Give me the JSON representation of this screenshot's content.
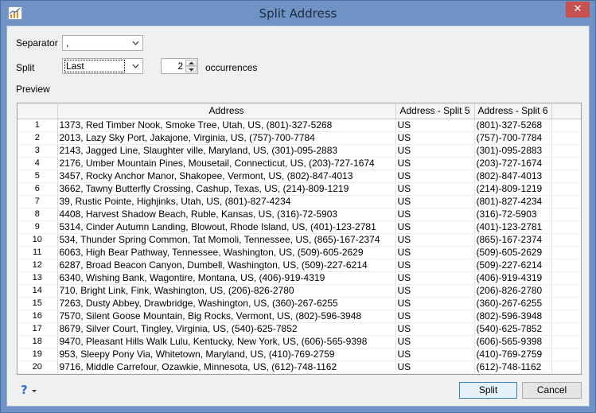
{
  "window": {
    "title": "Split Address",
    "close_symbol": "✕",
    "app_icon": "chart-icon"
  },
  "form": {
    "separator_label": "Separator",
    "separator_value": ",",
    "split_label": "Split",
    "split_value": "Last",
    "occurrences_value": "2",
    "occurrences_label": "occurrences",
    "preview_label": "Preview"
  },
  "table": {
    "columns": [
      "",
      "Address",
      "Address - Split 5",
      "Address - Split 6"
    ],
    "rows": [
      [
        "1",
        "1373, Red Timber Nook, Smoke Tree, Utah, US, (801)-327-5268",
        "US",
        "(801)-327-5268"
      ],
      [
        "2",
        "2013, Lazy Sky Port, Jakajone, Virginia, US, (757)-700-7784",
        "US",
        "(757)-700-7784"
      ],
      [
        "3",
        "2143, Jagged Line, Slaughter ville, Maryland, US, (301)-095-2883",
        "US",
        "(301)-095-2883"
      ],
      [
        "4",
        "2176, Umber Mountain Pines, Mousetail, Connecticut, US, (203)-727-1674",
        "US",
        "(203)-727-1674"
      ],
      [
        "5",
        "3457, Rocky Anchor Manor, Shakopee, Vermont, US, (802)-847-4013",
        "US",
        "(802)-847-4013"
      ],
      [
        "6",
        "3662, Tawny Butterfly Crossing, Cashup, Texas, US, (214)-809-1219",
        "US",
        "(214)-809-1219"
      ],
      [
        "7",
        "39, Rustic Pointe, Highjinks, Utah, US, (801)-827-4234",
        "US",
        "(801)-827-4234"
      ],
      [
        "8",
        "4408, Harvest Shadow Beach, Ruble, Kansas, US, (316)-72-5903",
        "US",
        "(316)-72-5903"
      ],
      [
        "9",
        "5314, Cinder Autumn Landing, Blowout, Rhode Island, US, (401)-123-2781",
        "US",
        "(401)-123-2781"
      ],
      [
        "10",
        "534, Thunder Spring Common, Tat Momoli, Tennessee, US, (865)-167-2374",
        "US",
        "(865)-167-2374"
      ],
      [
        "11",
        "6063, High Bear Pathway, Tennessee, Washington, US, (509)-605-2629",
        "US",
        "(509)-605-2629"
      ],
      [
        "12",
        "6287, Broad Beacon Canyon, Dumbell, Washington, US, (509)-227-6214",
        "US",
        "(509)-227-6214"
      ],
      [
        "13",
        "6340, Wishing Bank, Wagontire, Montana, US, (406)-919-4319",
        "US",
        "(406)-919-4319"
      ],
      [
        "14",
        "710, Bright Link, Fink, Washington, US, (206)-826-2780",
        "US",
        "(206)-826-2780"
      ],
      [
        "15",
        "7263, Dusty Abbey, Drawbridge, Washington, US, (360)-267-6255",
        "US",
        "(360)-267-6255"
      ],
      [
        "16",
        "7570, Silent Goose Mountain, Big Rocks, Vermont, US, (802)-596-3948",
        "US",
        "(802)-596-3948"
      ],
      [
        "17",
        "8679, Silver Court, Tingley, Virginia, US, (540)-625-7852",
        "US",
        "(540)-625-7852"
      ],
      [
        "18",
        "9470, Pleasant Hills Walk Lulu, Kentucky, New York, US, (606)-565-9398",
        "US",
        "(606)-565-9398"
      ],
      [
        "19",
        "953, Sleepy Pony Via, Whitetown, Maryland, US, (410)-769-2759",
        "US",
        "(410)-769-2759"
      ],
      [
        "20",
        "9716, Middle Carrefour, Ozawkie, Minnesota, US, (612)-748-1162",
        "US",
        "(612)-748-1162"
      ]
    ]
  },
  "footer": {
    "help_icon": "help-icon",
    "help_glyph": "?",
    "split_button": "Split",
    "cancel_button": "Cancel"
  },
  "colors": {
    "title_bar": "#6f93c4",
    "close_button": "#c75050",
    "default_button_border": "#3c7fb1"
  }
}
